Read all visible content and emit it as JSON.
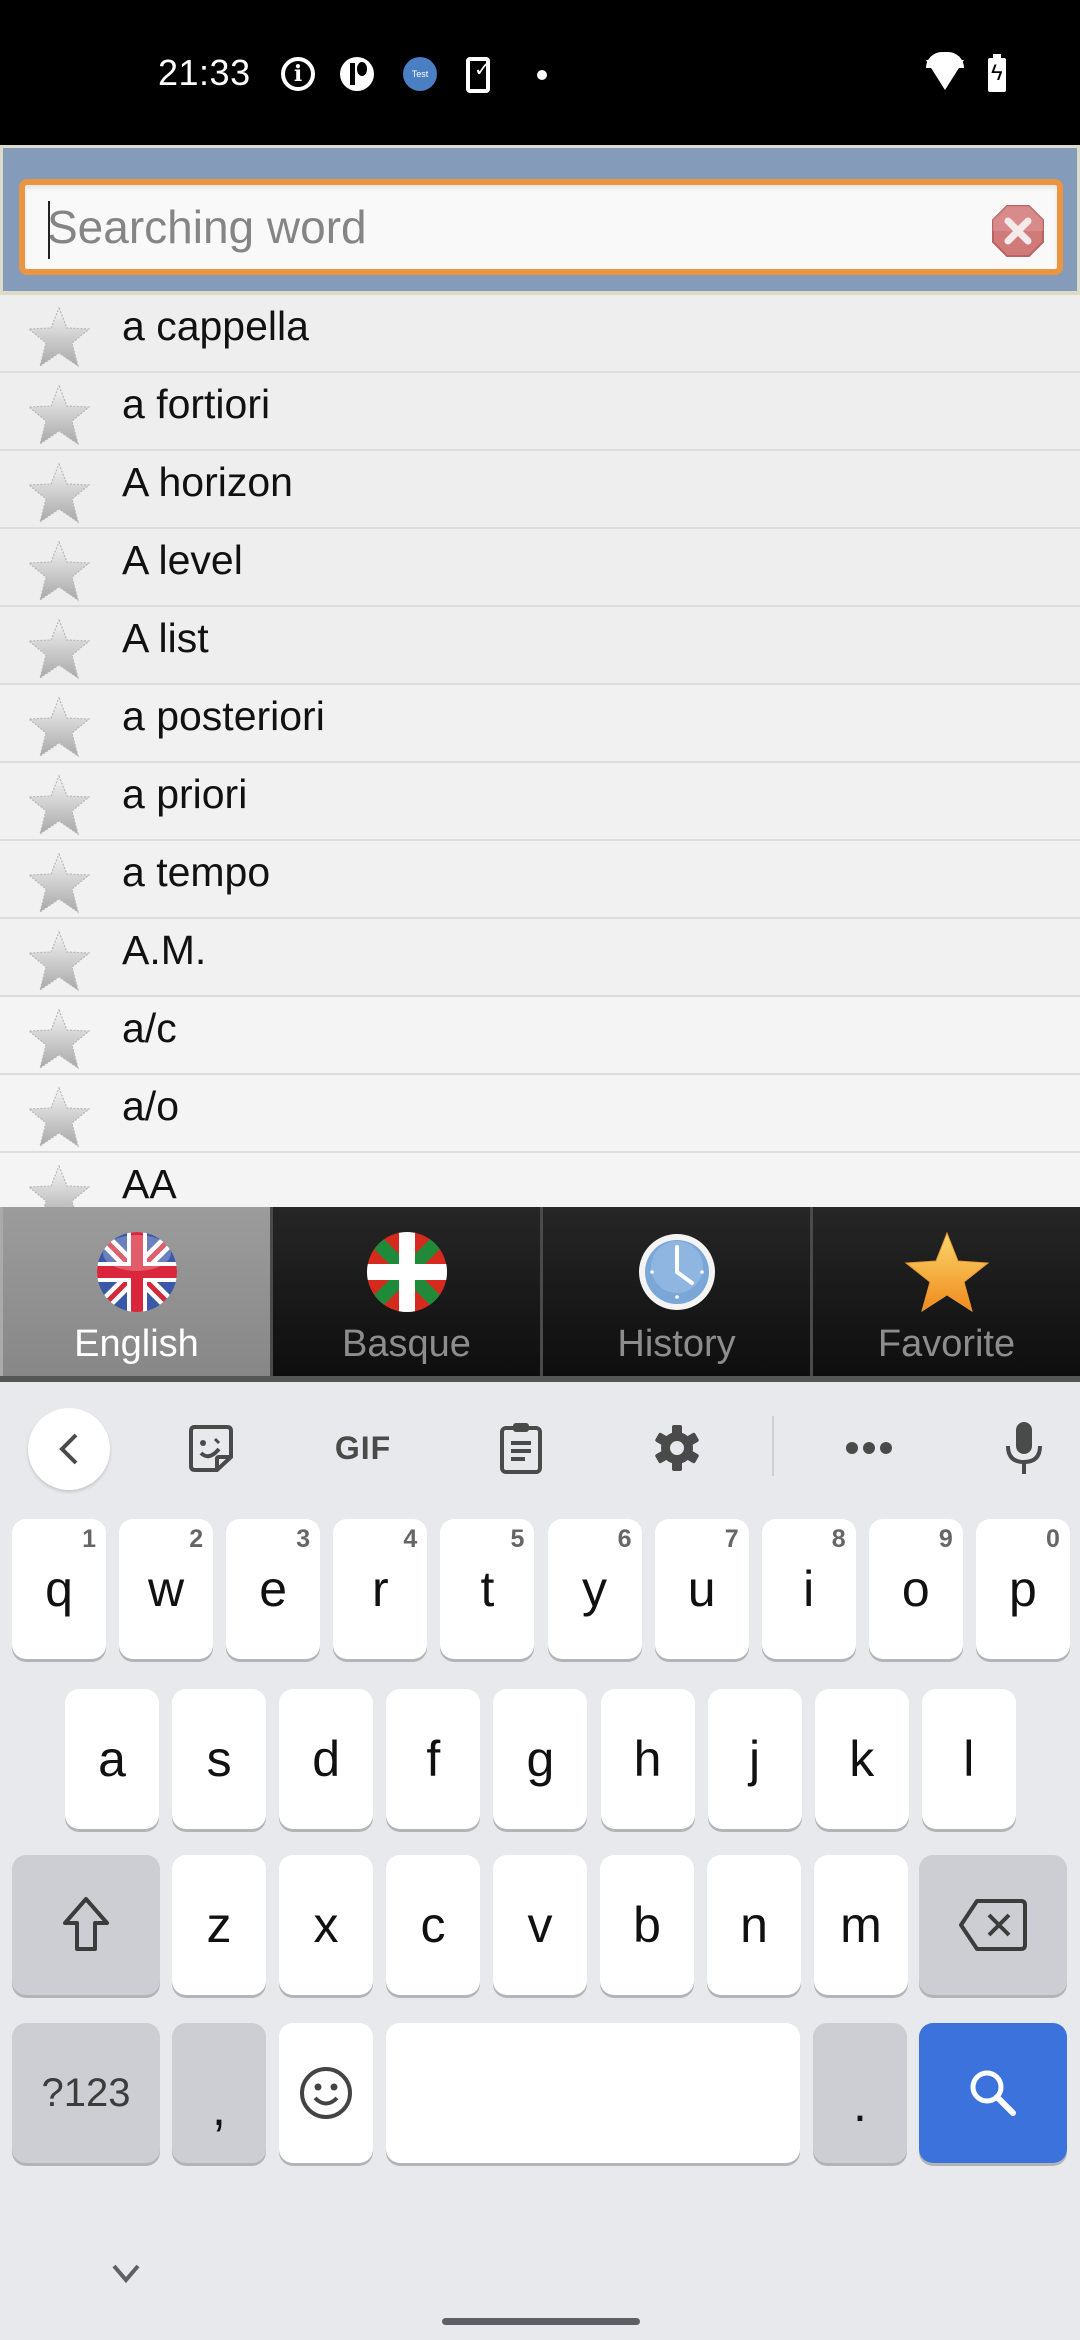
{
  "status_bar": {
    "time": "21:33",
    "icons": [
      "info-icon",
      "app-p-icon",
      "test-app-icon",
      "phone-check-icon",
      "notification-dot-icon"
    ],
    "right_icons": [
      "wifi-icon",
      "battery-charging-icon"
    ],
    "test_label": "Test"
  },
  "search": {
    "placeholder": "Searching word",
    "value": "",
    "clear_icon": "clear-icon"
  },
  "word_list": {
    "items": [
      {
        "word": "a cappella",
        "favorite": false
      },
      {
        "word": "a fortiori",
        "favorite": false
      },
      {
        "word": "A horizon",
        "favorite": false
      },
      {
        "word": "A level",
        "favorite": false
      },
      {
        "word": "A list",
        "favorite": false
      },
      {
        "word": "a posteriori",
        "favorite": false
      },
      {
        "word": "a priori",
        "favorite": false
      },
      {
        "word": "a tempo",
        "favorite": false
      },
      {
        "word": "A.M.",
        "favorite": false
      },
      {
        "word": "a/c",
        "favorite": false
      },
      {
        "word": "a/o",
        "favorite": false
      },
      {
        "word": "AA",
        "favorite": false
      }
    ]
  },
  "tabs": [
    {
      "label": "English",
      "icon": "uk-flag-icon",
      "active": true
    },
    {
      "label": "Basque",
      "icon": "basque-flag-icon",
      "active": false
    },
    {
      "label": "History",
      "icon": "clock-icon",
      "active": false
    },
    {
      "label": "Favorite",
      "icon": "star-icon",
      "active": false
    }
  ],
  "keyboard": {
    "toolbar": {
      "gif_label": "GIF",
      "icons": [
        "back-icon",
        "sticker-icon",
        "gif-icon",
        "clipboard-icon",
        "settings-icon",
        "more-icon",
        "microphone-icon"
      ]
    },
    "row1": [
      {
        "key": "q",
        "hint": "1"
      },
      {
        "key": "w",
        "hint": "2"
      },
      {
        "key": "e",
        "hint": "3"
      },
      {
        "key": "r",
        "hint": "4"
      },
      {
        "key": "t",
        "hint": "5"
      },
      {
        "key": "y",
        "hint": "6"
      },
      {
        "key": "u",
        "hint": "7"
      },
      {
        "key": "i",
        "hint": "8"
      },
      {
        "key": "o",
        "hint": "9"
      },
      {
        "key": "p",
        "hint": "0"
      }
    ],
    "row2": [
      "a",
      "s",
      "d",
      "f",
      "g",
      "h",
      "j",
      "k",
      "l"
    ],
    "row3": [
      "z",
      "x",
      "c",
      "v",
      "b",
      "n",
      "m"
    ],
    "symbols_label": "?123",
    "comma": ",",
    "period": ".",
    "action_key": "search",
    "colors": {
      "action": "#3b72dc",
      "background": "#e8e9ec"
    }
  },
  "colors": {
    "header_bg": "#849cba",
    "search_border": "#ec9540",
    "tab_active_bg": "#8f8f8f",
    "tab_inactive_bg": "#1a1a1a"
  }
}
